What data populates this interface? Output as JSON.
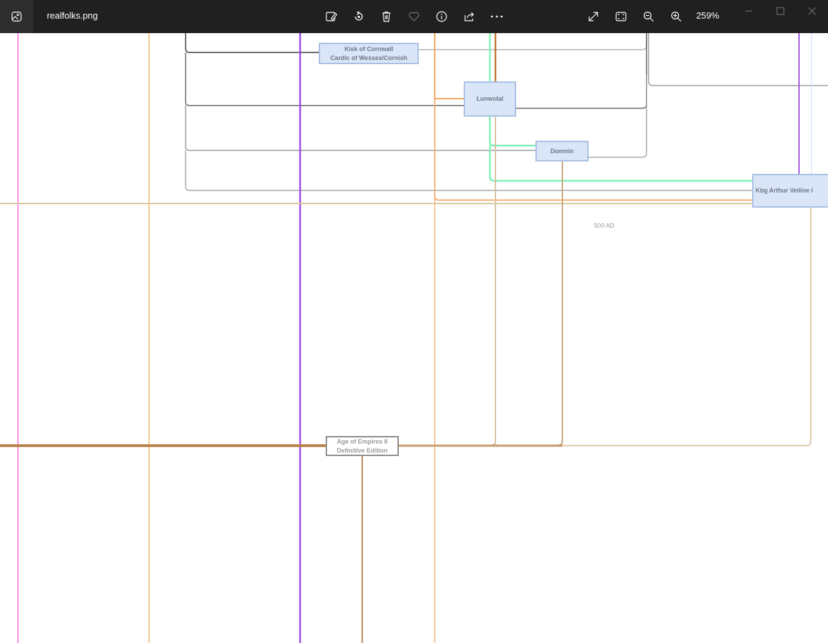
{
  "window": {
    "file_name": "realfolks.png",
    "zoom_level": "259%"
  },
  "toolbar": {
    "icons": [
      "edit-image-icon",
      "rotate-icon",
      "delete-icon",
      "favorite-icon",
      "info-icon",
      "share-icon",
      "more-icon",
      "fullscreen-icon",
      "fit-to-window-icon",
      "zoom-out-icon",
      "zoom-in-icon"
    ]
  },
  "window_controls": [
    "minimize-icon",
    "maximize-icon",
    "close-icon"
  ],
  "diagram": {
    "nodes": {
      "cornwall_line1": "Kisk of Cornwall",
      "cornwall_line2": "Cardic of Wessex/Cornish",
      "node_center": "Lunwstal",
      "node_small": "Domnin",
      "node_right": "Kbg Arthur Veiline I",
      "game_line1": "Age of Empires II",
      "game_line2": "Definitive Edition"
    },
    "year_label": "500 AD",
    "colors": {
      "pink": "#ff8be6",
      "light_orange": "#f6c98a",
      "purple": "#9b48e0",
      "orange": "#f2a55a",
      "brown": "#b9824a",
      "tan": "#d8c7a0",
      "gray": "#8c8c8c",
      "green": "#7ff0b5",
      "node_fill": "#dae6f8",
      "node_border": "#a9c0e4"
    }
  }
}
